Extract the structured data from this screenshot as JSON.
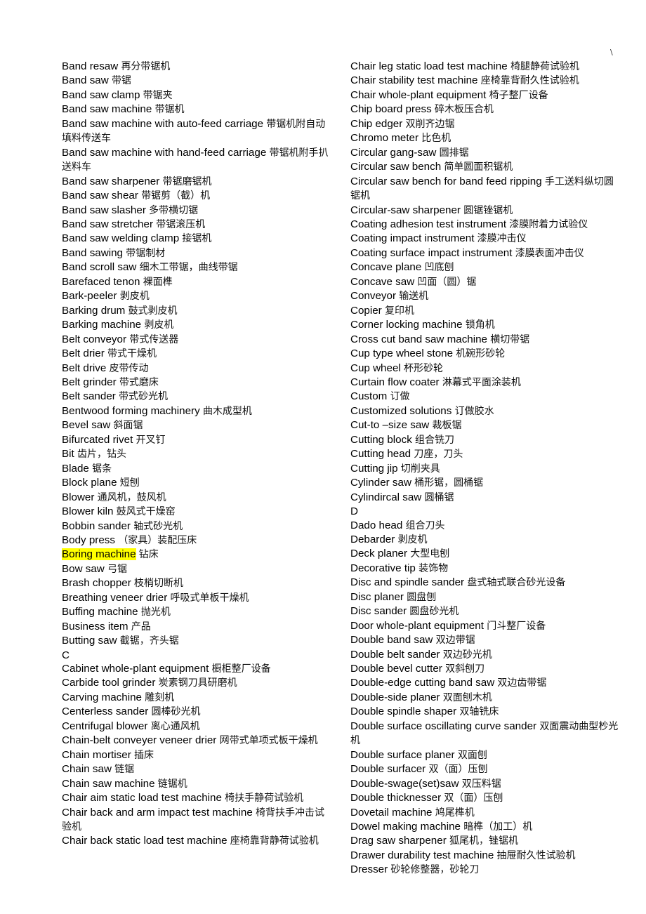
{
  "corner_mark": "\\",
  "highlight_color": "#ffff00",
  "left_column": [
    {
      "en": "Band resaw",
      "zh": "再分带锯机"
    },
    {
      "en": "Band saw",
      "zh": "带锯"
    },
    {
      "en": "Band saw clamp",
      "zh": "带锯夹"
    },
    {
      "en": "Band saw machine",
      "zh": "带锯机"
    },
    {
      "en": "Band saw machine with auto-feed carriage",
      "zh": "带锯机附自动填料传送车"
    },
    {
      "en": "Band saw machine with hand-feed carriage",
      "zh": "带锯机附手扒送料车"
    },
    {
      "en": "Band saw sharpener",
      "zh": "带锯磨锯机"
    },
    {
      "en": "Band saw shear",
      "zh": "带锯剪（截）机"
    },
    {
      "en": "Band saw slasher",
      "zh": "多带横切锯"
    },
    {
      "en": "Band saw stretcher",
      "zh": "带锯滚压机"
    },
    {
      "en": "Band saw welding clamp",
      "zh": "接锯机"
    },
    {
      "en": "Band sawing",
      "zh": "带锯制材"
    },
    {
      "en": "Band scroll saw",
      "zh": "细木工带锯，曲线带锯"
    },
    {
      "en": "Barefaced tenon",
      "zh": "裸面榫"
    },
    {
      "en": "Bark-peeler",
      "zh": "剥皮机"
    },
    {
      "en": "Barking drum",
      "zh": "鼓式剥皮机"
    },
    {
      "en": "Barking machine",
      "zh": "剥皮机"
    },
    {
      "en": "Belt conveyor",
      "zh": "带式传送器"
    },
    {
      "en": "Belt drier",
      "zh": "带式干燥机"
    },
    {
      "en": "Belt drive",
      "zh": "皮带传动"
    },
    {
      "en": "Belt grinder",
      "zh": "带式磨床"
    },
    {
      "en": "Belt sander",
      "zh": "带式砂光机"
    },
    {
      "en": "Bentwood forming machinery",
      "zh": "曲木成型机"
    },
    {
      "en": "Bevel saw",
      "zh": "斜面锯"
    },
    {
      "en": "Bifurcated rivet",
      "zh": "开叉钉"
    },
    {
      "en": "Bit",
      "zh": "齿片，钻头"
    },
    {
      "en": "Blade",
      "zh": "锯条"
    },
    {
      "en": "Block plane",
      "zh": "短刨"
    },
    {
      "en": "Blower",
      "zh": "通风机，鼓风机"
    },
    {
      "en": "Blower kiln",
      "zh": "鼓风式干燥窑"
    },
    {
      "en": "Bobbin sander",
      "zh": "轴式砂光机"
    },
    {
      "en": "Body press",
      "zh": "（家具）装配压床"
    },
    {
      "en": "Boring machine",
      "zh": "钻床",
      "highlighted": true
    },
    {
      "en": "Bow saw",
      "zh": "弓锯"
    },
    {
      "en": "Brash chopper",
      "zh": "枝梢切断机"
    },
    {
      "en": "Breathing veneer drier",
      "zh": "呼吸式单板干燥机"
    },
    {
      "en": "Buffing machine",
      "zh": "抛光机"
    },
    {
      "en": "Business item",
      "zh": "产品"
    },
    {
      "en": "Butting saw",
      "zh": "截锯，齐头锯"
    },
    {
      "en": "C",
      "zh": ""
    },
    {
      "en": "Cabinet whole-plant equipment",
      "zh": "橱柜整厂设备"
    },
    {
      "en": "Carbide tool grinder",
      "zh": "炭素钢刀具研磨机"
    },
    {
      "en": "Carving machine",
      "zh": "雕刻机"
    },
    {
      "en": "Centerless sander",
      "zh": "圆棒砂光机"
    },
    {
      "en": "Centrifugal blower",
      "zh": "离心通风机"
    },
    {
      "en": "Chain-belt conveyer veneer drier",
      "zh": "网带式单项式板干燥机"
    },
    {
      "en": "Chain mortiser",
      "zh": "插床"
    },
    {
      "en": "Chain saw",
      "zh": "链锯"
    },
    {
      "en": "Chain saw machine",
      "zh": "链锯机"
    },
    {
      "en": "Chair aim static load test machine",
      "zh": "椅扶手静荷试验机"
    },
    {
      "en": "Chair back and arm impact test machine",
      "zh": "椅背扶手冲击试验机"
    },
    {
      "en": "Chair back static load test machine",
      "zh": "座椅靠背静荷试验机"
    }
  ],
  "right_column": [
    {
      "en": "Chair leg static load test machine",
      "zh": "椅腿静荷试验机"
    },
    {
      "en": "Chair stability test machine",
      "zh": "座椅靠背耐久性试验机"
    },
    {
      "en": "Chair whole-plant equipment",
      "zh": "椅子整厂设备"
    },
    {
      "en": "Chip board press",
      "zh": "碎木板压合机"
    },
    {
      "en": "Chip edger",
      "zh": "双削齐边锯"
    },
    {
      "en": "Chromo meter",
      "zh": "比色机"
    },
    {
      "en": "Circular gang-saw",
      "zh": "圆排锯"
    },
    {
      "en": "Circular saw bench",
      "zh": "简单圆面积锯机"
    },
    {
      "en": "Circular saw bench for band feed ripping",
      "zh": "手工送料纵切圆锯机"
    },
    {
      "en": "Circular-saw sharpener",
      "zh": "圆锯锉锯机"
    },
    {
      "en": "Coating adhesion test instrument",
      "zh": "漆膜附着力试验仪"
    },
    {
      "en": "Coating impact instrument",
      "zh": "漆膜冲击仪"
    },
    {
      "en": "Coating surface impact instrument",
      "zh": "漆膜表面冲击仪"
    },
    {
      "en": "Concave plane",
      "zh": "凹底刨"
    },
    {
      "en": "Concave saw",
      "zh": "凹面（圆）锯"
    },
    {
      "en": "Conveyor",
      "zh": "输送机"
    },
    {
      "en": "Copier",
      "zh": "复印机"
    },
    {
      "en": "Corner locking machine",
      "zh": "锁角机"
    },
    {
      "en": "Cross cut band saw machine",
      "zh": "横切带锯"
    },
    {
      "en": "Cup type wheel stone",
      "zh": "机碗形砂轮"
    },
    {
      "en": "Cup wheel",
      "zh": "杯形砂轮"
    },
    {
      "en": "Curtain flow coater",
      "zh": "淋幕式平面涂装机"
    },
    {
      "en": "Custom",
      "zh": "订做"
    },
    {
      "en": "Customized solutions",
      "zh": "订做胶水"
    },
    {
      "en": "Cut-to –size saw",
      "zh": "裁板锯"
    },
    {
      "en": "Cutting block",
      "zh": "组合铣刀"
    },
    {
      "en": "Cutting head",
      "zh": "刀座，刀头"
    },
    {
      "en": "Cutting jip",
      "zh": "切削夹具"
    },
    {
      "en": "Cylinder saw",
      "zh": "桶形锯，圆桶锯"
    },
    {
      "en": "Cylindircal saw",
      "zh": "圆桶锯"
    },
    {
      "en": "D",
      "zh": ""
    },
    {
      "en": "Dado head",
      "zh": "组合刀头"
    },
    {
      "en": "Debarder",
      "zh": "剥皮机"
    },
    {
      "en": "Deck planer",
      "zh": "大型电刨"
    },
    {
      "en": "Decorative tip",
      "zh": "装饰物"
    },
    {
      "en": "Disc and spindle sander",
      "zh": "盘式轴式联合砂光设备"
    },
    {
      "en": "Disc planer",
      "zh": "圆盘刨"
    },
    {
      "en": "Disc sander",
      "zh": "圆盘砂光机"
    },
    {
      "en": "Door whole-plant equipment",
      "zh": "门斗整厂设备"
    },
    {
      "en": "Double band saw",
      "zh": "双边带锯"
    },
    {
      "en": "Double belt sander",
      "zh": "双边砂光机"
    },
    {
      "en": "Double bevel cutter",
      "zh": "双斜刨刀"
    },
    {
      "en": "Double-edge cutting band saw",
      "zh": "双边齿带锯"
    },
    {
      "en": "Double-side planer",
      "zh": "双面刨木机"
    },
    {
      "en": "Double spindle shaper",
      "zh": "双轴铣床"
    },
    {
      "en": "Double surface oscillating curve sander",
      "zh": "双面震动曲型杪光机"
    },
    {
      "en": "Double surface planer",
      "zh": "双面刨"
    },
    {
      "en": "Double surfacer",
      "zh": "双（面）压刨"
    },
    {
      "en": "Double-swage(set)saw",
      "zh": "双压料锯"
    },
    {
      "en": "Double thicknesser",
      "zh": "双（面）压刨"
    },
    {
      "en": "Dovetail machine",
      "zh": "鸠尾榫机"
    },
    {
      "en": "Dowel making machine",
      "zh": "暗榫（加工）机"
    },
    {
      "en": "Drag saw sharpener",
      "zh": "狐尾机，锉锯机"
    },
    {
      "en": "Drawer durability test machine",
      "zh": "抽屉耐久性试验机"
    },
    {
      "en": "Dresser",
      "zh": "砂轮修整器，砂轮刀"
    }
  ]
}
